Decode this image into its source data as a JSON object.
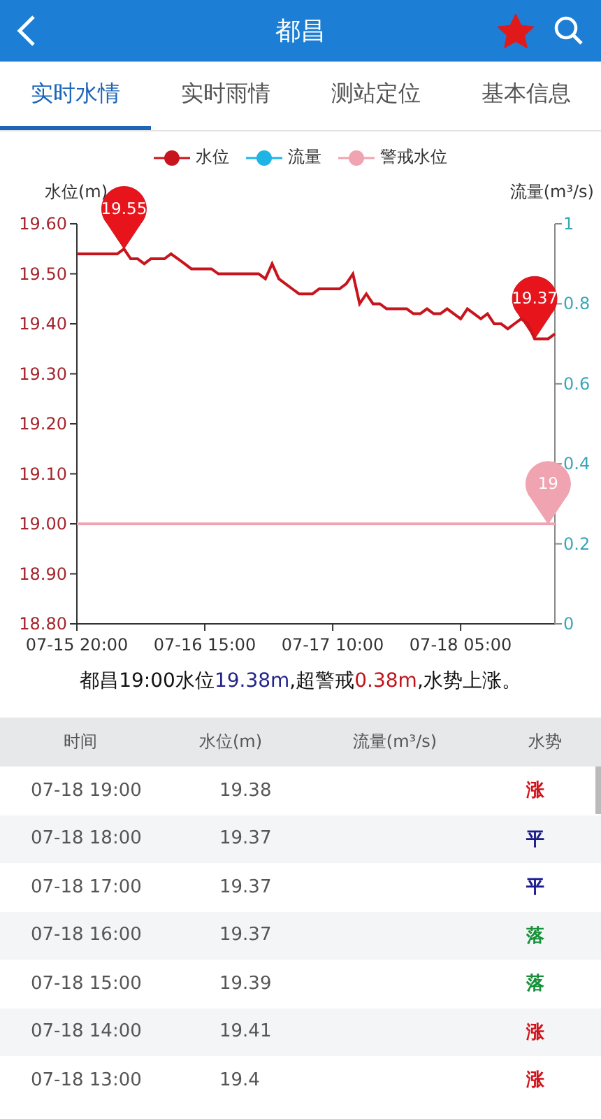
{
  "header": {
    "title": "都昌",
    "favorited": true
  },
  "tabs": [
    {
      "label": "实时水情",
      "selected": true
    },
    {
      "label": "实时雨情",
      "selected": false
    },
    {
      "label": "测站定位",
      "selected": false
    },
    {
      "label": "基本信息",
      "selected": false
    }
  ],
  "chart": {
    "left_axis_title": "水位(m)",
    "right_axis": {
      "title": "流量(m³/s)",
      "ticks": [
        "1",
        "0.8",
        "0.6",
        "0.4",
        "0.2",
        "0"
      ]
    },
    "chart_data": {
      "type": "line",
      "ylim": [
        18.8,
        19.6
      ],
      "categories": [
        "07-15 20:00",
        null,
        null,
        null,
        null,
        null,
        null,
        null,
        null,
        null,
        null,
        null,
        null,
        null,
        null,
        null,
        null,
        null,
        null,
        "07-16 15:00",
        null,
        null,
        null,
        null,
        null,
        null,
        null,
        null,
        null,
        null,
        null,
        null,
        null,
        null,
        null,
        null,
        null,
        null,
        "07-17 10:00",
        null,
        null,
        null,
        null,
        null,
        null,
        null,
        null,
        null,
        null,
        null,
        null,
        null,
        null,
        null,
        null,
        null,
        null,
        "07-18 05:00",
        null,
        null,
        null,
        null,
        null,
        null,
        null,
        null,
        null,
        null,
        null,
        null,
        null,
        null
      ],
      "yticks": [
        {
          "value": 18.8,
          "label": "18.80"
        },
        {
          "value": 18.9,
          "label": "18.90"
        },
        {
          "value": 19,
          "label": "19.00"
        },
        {
          "value": 19.1,
          "label": "19.10"
        },
        {
          "value": 19.2,
          "label": "19.20"
        },
        {
          "value": 19.3,
          "label": "19.30"
        },
        {
          "value": 19.4,
          "label": "19.40"
        },
        {
          "value": 19.5,
          "label": "19.50"
        },
        {
          "value": 19.6,
          "label": "19.60"
        }
      ],
      "series": [
        {
          "name": "水位",
          "color": "#c8151d",
          "values": [
            19.54,
            19.54,
            19.54,
            19.54,
            19.54,
            19.54,
            19.54,
            19.55,
            19.53,
            19.53,
            19.52,
            19.53,
            19.53,
            19.53,
            19.54,
            19.53,
            19.52,
            19.51,
            19.51,
            19.51,
            19.51,
            19.5,
            19.5,
            19.5,
            19.5,
            19.5,
            19.5,
            19.5,
            19.49,
            19.52,
            19.49,
            19.48,
            19.47,
            19.46,
            19.46,
            19.46,
            19.47,
            19.47,
            19.47,
            19.47,
            19.48,
            19.5,
            19.44,
            19.46,
            19.44,
            19.44,
            19.43,
            19.43,
            19.43,
            19.43,
            19.42,
            19.42,
            19.43,
            19.42,
            19.42,
            19.43,
            19.42,
            19.41,
            19.43,
            19.42,
            19.41,
            19.42,
            19.4,
            19.4,
            19.39,
            19.4,
            19.41,
            19.4,
            19.37,
            19.37,
            19.37,
            19.38
          ]
        },
        {
          "name": "流量",
          "color": "#1fb4e6",
          "values": [
            null,
            null,
            null,
            null,
            null,
            null,
            null,
            null,
            null,
            null,
            null,
            null,
            null,
            null,
            null,
            null,
            null,
            null,
            null,
            null,
            null,
            null,
            null,
            null,
            null,
            null,
            null,
            null,
            null,
            null,
            null,
            null,
            null,
            null,
            null,
            null,
            null,
            null,
            null,
            null,
            null,
            null,
            null,
            null,
            null,
            null,
            null,
            null,
            null,
            null,
            null,
            null,
            null,
            null,
            null,
            null,
            null,
            null,
            null,
            null,
            null,
            null,
            null,
            null,
            null,
            null,
            null,
            null,
            null,
            null,
            null,
            null
          ]
        },
        {
          "name": "警戒水位",
          "color": "#f0a3b0",
          "values": [
            19,
            19,
            19,
            19,
            19,
            19,
            19,
            19,
            19,
            19,
            19,
            19,
            19,
            19,
            19,
            19,
            19,
            19,
            19,
            19,
            19,
            19,
            19,
            19,
            19,
            19,
            19,
            19,
            19,
            19,
            19,
            19,
            19,
            19,
            19,
            19,
            19,
            19,
            19,
            19,
            19,
            19,
            19,
            19,
            19,
            19,
            19,
            19,
            19,
            19,
            19,
            19,
            19,
            19,
            19,
            19,
            19,
            19,
            19,
            19,
            19,
            19,
            19,
            19,
            19,
            19,
            19,
            19,
            19,
            19,
            19,
            19
          ]
        }
      ]
    },
    "pins": [
      {
        "kind": "max",
        "text": "19.55"
      },
      {
        "kind": "min",
        "text": "19.37"
      },
      {
        "kind": "last",
        "text": "19"
      }
    ]
  },
  "summary": [
    {
      "text": "都昌19:00水位",
      "color": "#111111"
    },
    {
      "text": "19.38m",
      "color": "#23238a"
    },
    {
      "text": ",超警戒",
      "color": "#111111"
    },
    {
      "text": "0.38m",
      "color": "#c0131b"
    },
    {
      "text": ",水势上涨。",
      "color": "#111111"
    }
  ],
  "table": {
    "columns": [
      "时间",
      "水位(m)",
      "流量(m³/s)",
      "水势"
    ],
    "rows": [
      {
        "time": "07-18 19:00",
        "level": "19.38",
        "trend": "涨",
        "kind": "rise"
      },
      {
        "time": "07-18 18:00",
        "level": "19.37",
        "trend": "平",
        "kind": "flat"
      },
      {
        "time": "07-18 17:00",
        "level": "19.37",
        "trend": "平",
        "kind": "flat"
      },
      {
        "time": "07-18 16:00",
        "level": "19.37",
        "trend": "落",
        "kind": "fall"
      },
      {
        "time": "07-18 15:00",
        "level": "19.39",
        "trend": "落",
        "kind": "fall"
      },
      {
        "time": "07-18 14:00",
        "level": "19.41",
        "trend": "涨",
        "kind": "rise"
      },
      {
        "time": "07-18 13:00",
        "level": "19.4",
        "trend": "涨",
        "kind": "rise"
      }
    ]
  }
}
